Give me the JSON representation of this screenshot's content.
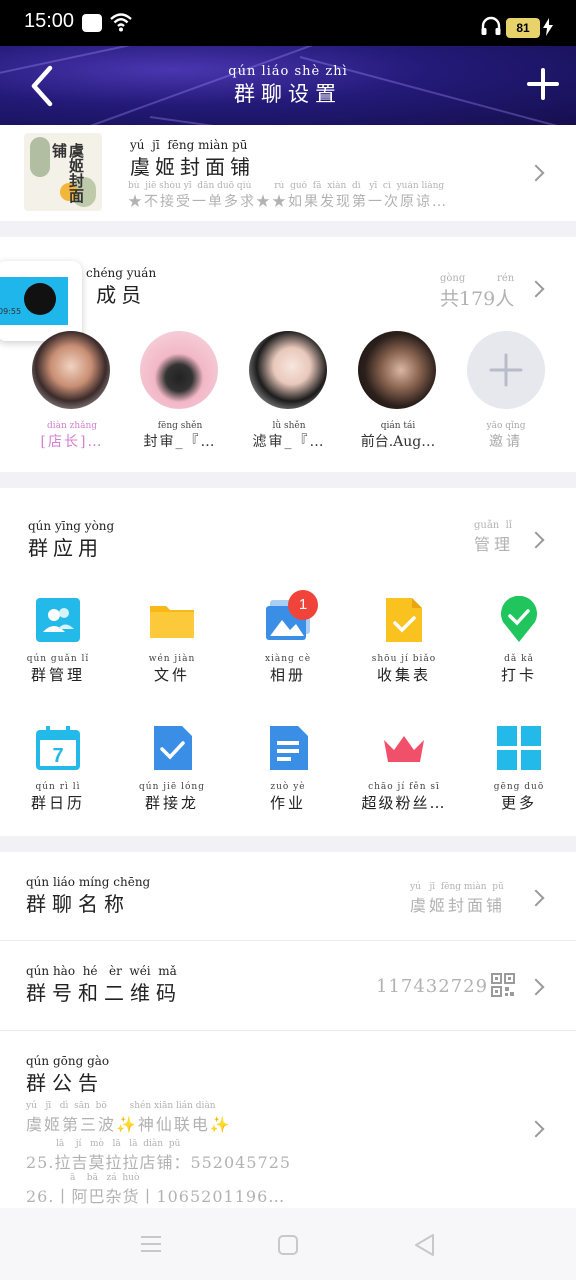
{
  "status_bar": {
    "time": "15:00",
    "battery": "81"
  },
  "header": {
    "title_pinyin": "qún liáo shè zhì",
    "title": "群聊设置"
  },
  "shop": {
    "name_pinyin": "yú  jī  fēng miàn pū",
    "name": "虞姬封面铺",
    "subtitle_pinyin": "bù  jiē shòu yī  dān duō qiú        rú  guǒ  fā  xiàn  dì   yī  cì  yuán liàng",
    "subtitle": "★不接受一单多求★★如果发现第一次原谅…",
    "logo_text": "虞姬封面铺"
  },
  "members": {
    "label_pinyin": "chéng yuán",
    "label": "成员",
    "count_pinyin": "gòng          rén",
    "count": "共179人",
    "floating_widget_text": "09:55",
    "list": [
      {
        "role_pinyin": "diàn zhǎng",
        "name": "[店长]…"
      },
      {
        "role_pinyin": "fēng shěn",
        "name": "封审_『…"
      },
      {
        "role_pinyin": "lǜ  shěn",
        "name": "滤审_『…"
      },
      {
        "role_pinyin": "qián tái",
        "name": "前台.Aug…"
      },
      {
        "role_pinyin": "yāo qǐng",
        "name": "邀请"
      }
    ]
  },
  "apps": {
    "label_pinyin": "qún yīng yòng",
    "label": "群应用",
    "manage_pinyin": "guǎn  lǐ",
    "manage": "管理",
    "album_badge": "1",
    "items": [
      {
        "pinyin": "qún guǎn  lǐ",
        "label": "群管理",
        "icon": "group-manage-icon"
      },
      {
        "pinyin": "wén jiàn",
        "label": "文件",
        "icon": "folder-icon"
      },
      {
        "pinyin": "xiàng  cè",
        "label": "相册",
        "icon": "album-icon"
      },
      {
        "pinyin": "shōu  jí  biǎo",
        "label": "收集表",
        "icon": "collect-form-icon"
      },
      {
        "pinyin": "dǎ   kǎ",
        "label": "打卡",
        "icon": "checkin-icon"
      },
      {
        "pinyin": "qún  rì   lì",
        "label": "群日历",
        "icon": "calendar-icon"
      },
      {
        "pinyin": "qún  jiē  lóng",
        "label": "群接龙",
        "icon": "relay-icon"
      },
      {
        "pinyin": "zuò  yè",
        "label": "作业",
        "icon": "homework-icon"
      },
      {
        "pinyin": "chāo  jí  fěn  sī",
        "label": "超级粉丝…",
        "icon": "super-fans-icon"
      },
      {
        "pinyin": "gēng duō",
        "label": "更多",
        "icon": "more-grid-icon"
      }
    ]
  },
  "group_name": {
    "label_pinyin": "qún liáo míng chēng",
    "label": "群聊名称",
    "value_pinyin": "yú   jī  fēng miàn  pū",
    "value": "虞姬封面铺"
  },
  "group_qr": {
    "label_pinyin": "qún hào  hé   èr  wéi  mǎ",
    "label": "群号和二维码",
    "value": "117432729"
  },
  "announcement": {
    "label_pinyin": "qún gōng gào",
    "label": "群公告",
    "line1_pinyin": "yú   jī   dì  sān  bō        shén xiān lián diàn",
    "line1": "虞姬第三波✨神仙联电✨",
    "line2_pinyin": "lā    jí   mò   lā   lā  diàn  pū",
    "line2": "25.拉吉莫拉拉店铺：552045725",
    "line3_pinyin": "ā    bā   zá  huò",
    "line3": "26.丨阿巴杂货丨1065201196…"
  }
}
